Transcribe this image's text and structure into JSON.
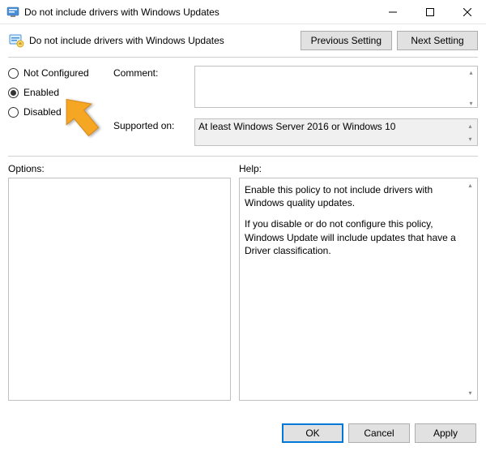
{
  "window": {
    "title": "Do not include drivers with Windows Updates"
  },
  "header": {
    "title": "Do not include drivers with Windows Updates",
    "prev_button": "Previous Setting",
    "next_button": "Next Setting"
  },
  "radios": {
    "not_configured": "Not Configured",
    "enabled": "Enabled",
    "disabled": "Disabled",
    "selected": "enabled"
  },
  "fields": {
    "comment_label": "Comment:",
    "comment_value": "",
    "supported_label": "Supported on:",
    "supported_value": "At least Windows Server 2016 or Windows 10"
  },
  "panels": {
    "options_label": "Options:",
    "help_label": "Help:",
    "help_text_1": "Enable this policy to not include drivers with Windows quality updates.",
    "help_text_2": "If you disable or do not configure this policy, Windows Update will include updates that have a Driver classification."
  },
  "footer": {
    "ok": "OK",
    "cancel": "Cancel",
    "apply": "Apply"
  },
  "colors": {
    "arrow": "#f5a623"
  }
}
